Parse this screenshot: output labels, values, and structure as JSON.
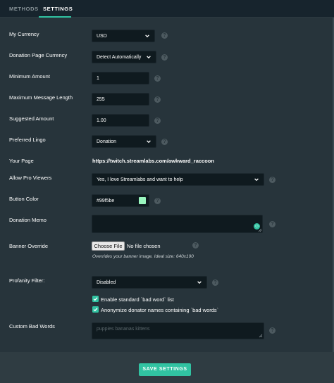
{
  "tabs": [
    {
      "label": "METHODS"
    },
    {
      "label": "SETTINGS"
    }
  ],
  "fields": {
    "currency": {
      "label": "My Currency",
      "value": "USD"
    },
    "page_currency": {
      "label": "Donation Page Currency",
      "value": "Detect Automatically"
    },
    "min_amount": {
      "label": "Minimum Amount",
      "value": "1"
    },
    "max_message": {
      "label": "Maximum Message Length",
      "value": "255"
    },
    "suggested": {
      "label": "Suggested Amount",
      "value": "1.00"
    },
    "lingo": {
      "label": "Preferred Lingo",
      "value": "Donation"
    },
    "your_page": {
      "label": "Your Page",
      "value": "https://twitch.streamlabs.com/awkward_raccoon"
    },
    "pro_viewers": {
      "label": "Allow Pro Viewers",
      "value": "Yes, I love Streamlabs and want to help"
    },
    "button_color": {
      "label": "Button Color",
      "value": "#99f5be"
    },
    "memo": {
      "label": "Donation Memo",
      "value": ""
    },
    "banner": {
      "label": "Banner Override",
      "button": "Choose File",
      "status": "No file chosen",
      "hint": "Overrides your banner image. Ideal size: 640x190"
    },
    "profanity": {
      "label": "Profanity Filter:",
      "value": "Disabled"
    },
    "checkboxes": [
      {
        "label": "Enable standard `bad word` list",
        "checked": true
      },
      {
        "label": "Anonymize donator names containing `bad words`",
        "checked": true
      }
    ],
    "bad_words": {
      "label": "Custom Bad Words",
      "placeholder": "puppies bananas kittens"
    }
  },
  "help_icon": "?",
  "emoji_icon": "☺",
  "colors": {
    "accent": "#31c3a2",
    "swatch": "#99f5be",
    "panel": "#27343b",
    "background": "#17242d"
  },
  "footer": {
    "save_label": "SAVE SETTINGS"
  }
}
